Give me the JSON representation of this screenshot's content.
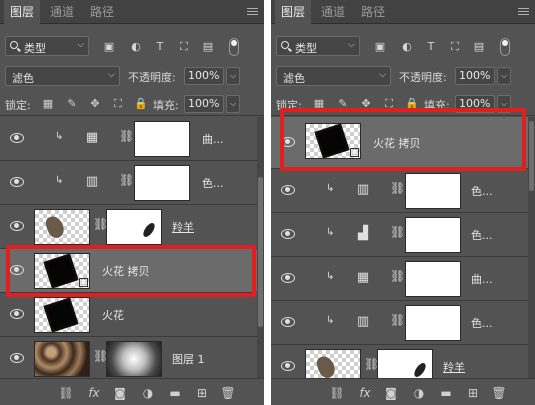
{
  "tabs": [
    "图层",
    "通道",
    "路径"
  ],
  "filter": {
    "label": "类型",
    "icons": [
      "image-filter-icon",
      "adjustment-filter-icon",
      "type-filter-icon",
      "shape-filter-icon",
      "smartobject-filter-icon"
    ]
  },
  "blend_mode": "滤色",
  "opacity_label": "不透明度:",
  "opacity_value": "100%",
  "lock_label": "锁定:",
  "fill_label": "填充:",
  "fill_value": "100%",
  "left_panel": {
    "layers": [
      {
        "name": "曲...",
        "type": "adjustment-curves",
        "clipped": true
      },
      {
        "name": "色...",
        "type": "adjustment-gradient",
        "clipped": true
      },
      {
        "name": "羚羊",
        "type": "image-with-mask"
      },
      {
        "name": "火花 拷贝",
        "type": "smart-object",
        "selected": true
      },
      {
        "name": "火花",
        "type": "image"
      },
      {
        "name": "图层 1",
        "type": "image-with-radial-mask"
      }
    ]
  },
  "right_panel": {
    "layers": [
      {
        "name": "火花 拷贝",
        "type": "smart-object",
        "selected": true
      },
      {
        "name": "色...",
        "type": "adjustment-gradient",
        "clipped": true
      },
      {
        "name": "色...",
        "type": "adjustment-levels",
        "clipped": true
      },
      {
        "name": "曲...",
        "type": "adjustment-curves",
        "clipped": true
      },
      {
        "name": "色...",
        "type": "adjustment-gradient",
        "clipped": true
      },
      {
        "name": "羚羊",
        "type": "image-with-mask"
      }
    ]
  },
  "bottom_icons": [
    "link-layers-icon",
    "fx-icon",
    "add-mask-icon",
    "adjustment-layer-icon",
    "new-group-icon",
    "new-layer-icon",
    "delete-layer-icon"
  ],
  "fx_label": "fx",
  "accent": {
    "highlight": "#e02020",
    "panel": "#535353"
  }
}
